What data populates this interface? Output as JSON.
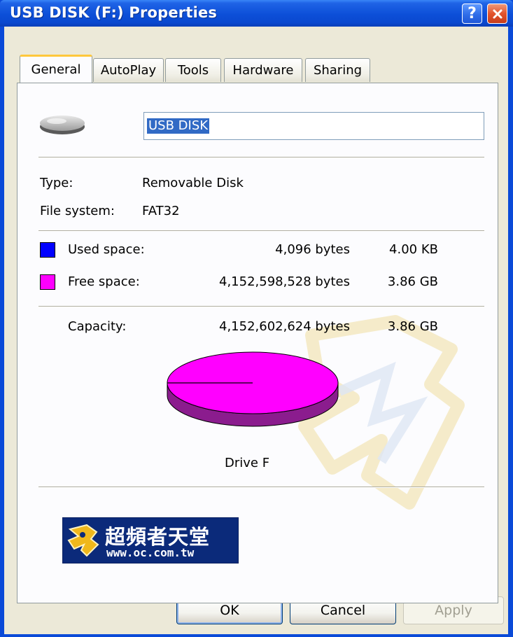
{
  "window": {
    "title": "USB DISK (F:) Properties",
    "help_icon": "question-mark-icon",
    "close_icon": "close-x-icon"
  },
  "tabs": [
    {
      "label": "General",
      "active": true
    },
    {
      "label": "AutoPlay",
      "active": false
    },
    {
      "label": "Tools",
      "active": false
    },
    {
      "label": "Hardware",
      "active": false
    },
    {
      "label": "Sharing",
      "active": false
    }
  ],
  "general": {
    "drive_icon": "removable-drive-icon",
    "name_value": "USB DISK",
    "type_label": "Type:",
    "type_value": "Removable Disk",
    "fs_label": "File system:",
    "fs_value": "FAT32",
    "used": {
      "label": "Used space:",
      "bytes": "4,096 bytes",
      "size": "4.00 KB",
      "color": "#0000ff"
    },
    "free": {
      "label": "Free space:",
      "bytes": "4,152,598,528 bytes",
      "size": "3.86 GB",
      "color": "#ff00ff"
    },
    "capacity": {
      "label": "Capacity:",
      "bytes": "4,152,602,624 bytes",
      "size": "3.86 GB"
    },
    "pie_caption": "Drive F",
    "pie_used_fraction": 1e-06,
    "pie_top_color": "#ff00ff",
    "pie_side_color": "#8b1c8e"
  },
  "banner": {
    "title": "超頻者天堂",
    "url": "www.oc.com.tw",
    "logo_icon": "mascot-logo-icon"
  },
  "buttons": {
    "ok": "OK",
    "cancel": "Cancel",
    "apply": "Apply"
  }
}
